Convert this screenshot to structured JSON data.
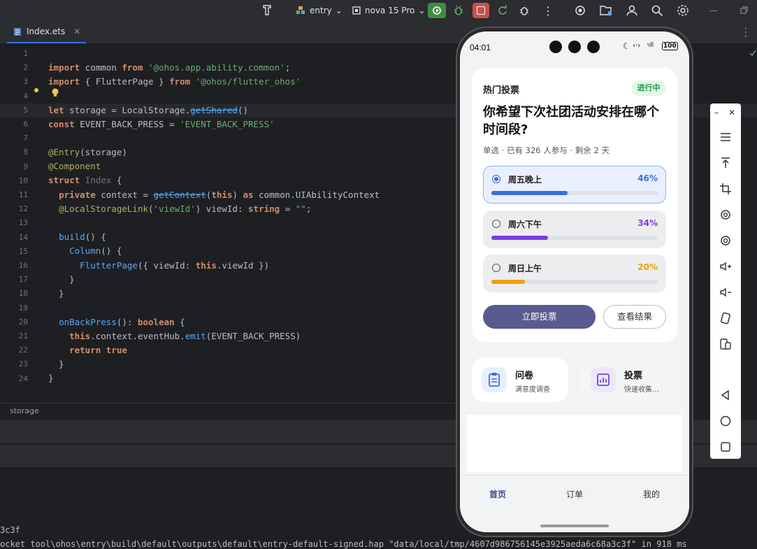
{
  "toolbar": {
    "module": "entry",
    "device": "nova 15 Pro"
  },
  "tab": {
    "filename": "Index.ets"
  },
  "code_lines": [
    {
      "n": "1"
    },
    {
      "n": "2"
    },
    {
      "n": "3"
    },
    {
      "n": "4"
    },
    {
      "n": "5"
    },
    {
      "n": "6"
    },
    {
      "n": "7"
    },
    {
      "n": "8"
    },
    {
      "n": "9"
    },
    {
      "n": "10"
    },
    {
      "n": "11"
    },
    {
      "n": "12"
    },
    {
      "n": "13"
    },
    {
      "n": "14"
    },
    {
      "n": "15"
    },
    {
      "n": "16"
    },
    {
      "n": "17"
    },
    {
      "n": "18"
    },
    {
      "n": "19"
    },
    {
      "n": "20"
    },
    {
      "n": "21"
    },
    {
      "n": "22"
    },
    {
      "n": "23"
    },
    {
      "n": "24"
    }
  ],
  "breadcrumb": "storage",
  "console": {
    "line1": "3c3f",
    "line2": "ocket tool\\ohos\\entry\\build\\default\\outputs\\default\\entry-default-signed.hap \"data/local/tmp/4607d986756145e3925aeda6c68a3c3f\" in 918 ms"
  },
  "phone": {
    "time": "04:01",
    "battery": "100",
    "poll": {
      "header": "热门投票",
      "status": "进行中",
      "question": "你希望下次社团活动安排在哪个时间段?",
      "meta": "单选 · 已有 326 人参与 · 剩余 2 天",
      "options": [
        {
          "label": "周五晚上",
          "percent": "46%",
          "value": 0.46,
          "color": "#3b6fe0",
          "selected": true
        },
        {
          "label": "周六下午",
          "percent": "34%",
          "value": 0.34,
          "color": "#7b3fe4",
          "selected": false
        },
        {
          "label": "周日上午",
          "percent": "20%",
          "value": 0.2,
          "color": "#f0a000",
          "selected": false
        }
      ],
      "vote_button": "立即投票",
      "results_button": "查看结果"
    },
    "features": [
      {
        "title": "问卷",
        "subtitle": "满意度调查",
        "icon": "clipboard-icon"
      },
      {
        "title": "投票",
        "subtitle": "快速收集…",
        "icon": "bar-chart-icon"
      }
    ],
    "nav": [
      "首页",
      "订单",
      "我的"
    ]
  }
}
